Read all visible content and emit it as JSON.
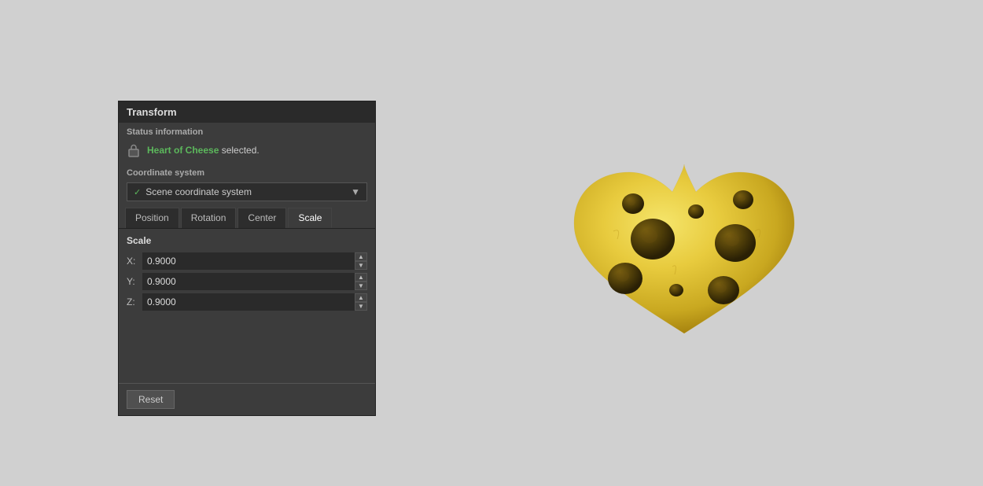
{
  "panel": {
    "title": "Transform",
    "status_section": "Status information",
    "object_name": "Heart of Cheese",
    "status_suffix": " selected.",
    "coord_section": "Coordinate system",
    "coord_value": "Scene coordinate system",
    "tabs": [
      "Position",
      "Rotation",
      "Center",
      "Scale"
    ],
    "active_tab": "Scale",
    "scale_section": "Scale",
    "x_label": "X:",
    "y_label": "Y:",
    "z_label": "Z:",
    "x_value": "0.9000",
    "y_value": "0.9000",
    "z_value": "0.9000",
    "reset_label": "Reset"
  }
}
